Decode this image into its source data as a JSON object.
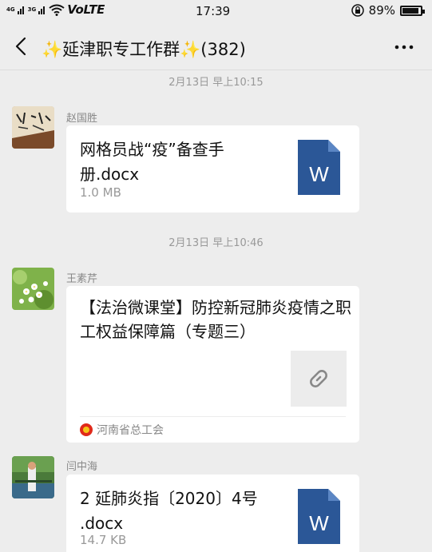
{
  "status_bar": {
    "signal_1": "4G",
    "signal_2": "3G",
    "network": "VoLTE",
    "time": "17:39",
    "battery": "89%",
    "battery_level": 0.89
  },
  "header": {
    "title": "✨延津职专工作群✨(382)"
  },
  "messages": [
    {
      "timestamp": "2月13日 早上10:15",
      "sender": "赵国胜",
      "type": "file",
      "file_name": "网格员战“疫”备查手册.docx",
      "file_size": "1.0 MB",
      "file_icon": "word-doc-icon",
      "file_icon_letter": "W"
    },
    {
      "timestamp": "2月13日 早上10:46",
      "sender": "王素芹",
      "type": "link",
      "link_title": "【法治微课堂】防控新冠肺炎疫情之职工权益保障篇（专题三）",
      "thumb_icon": "link-icon",
      "source": "河南省总工会"
    },
    {
      "sender": "闫中海",
      "type": "file",
      "file_name": "2 延肺炎指〔2020〕4号 .docx",
      "file_size": "14.7 KB",
      "file_icon": "word-doc-icon",
      "file_icon_letter": "W"
    }
  ],
  "colors": {
    "background": "#ededed",
    "bubble": "#ffffff",
    "word_blue": "#2b5797",
    "meta_gray": "#999999",
    "source_red": "#e02a1a"
  }
}
